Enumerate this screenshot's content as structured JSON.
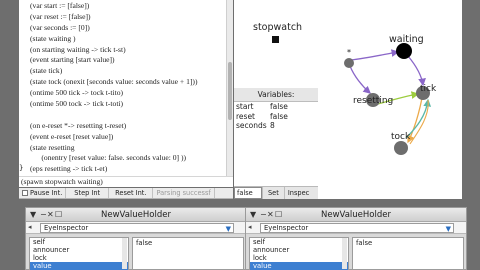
{
  "code": {
    "lines": [
      "(var start := [false])",
      "(var reset := [false])",
      "(var seconds := [0])",
      "(state waiting )",
      "(on starting waiting -> tick t-st)",
      "(event starting [start value])",
      "(state tick)",
      "(state tock (onexit [seconds value: seconds value + 1]))",
      "(ontime 500 tick -> tock t-tito)",
      "(ontime 500 tock -> tick t-toti)",
      "",
      "(on e-reset *-> resetting t-reset)",
      "(event e-reset [reset value])",
      "(state resetting",
      "      (onentry [reset value: false. seconds value: 0] ))",
      "(eps resetting -> tick t-et)",
      "",
      "(on e-stop *-> waiting t-es)",
      "(event e-stop [start value not])"
    ],
    "resize_glyph": "}",
    "eval_text": "(spawn stopwatch waiting)"
  },
  "controls": {
    "pause_label": "Pause Int.",
    "step_label": "Step Int",
    "reset_label": "Reset Int.",
    "parsing_label": "Parsing successf"
  },
  "morph": {
    "label": "stopwatch"
  },
  "variables": {
    "header": "Variables:",
    "rows": [
      {
        "name": "start",
        "value": "false"
      },
      {
        "name": "reset",
        "value": "false"
      },
      {
        "name": "seconds",
        "value": "8"
      }
    ],
    "set_value": "false",
    "set_label": "Set",
    "inspect_label": "Inspec"
  },
  "diagram": {
    "states": {
      "waiting": "waiting",
      "tick": "tick",
      "resetting": "resetting",
      "tock": "tock",
      "star": "*"
    }
  },
  "inspectors": [
    {
      "title": "NewValueHolder",
      "type_label": "EyeInspector",
      "fields": [
        "self",
        "announcer",
        "lock",
        "value"
      ],
      "selected_index": 3,
      "value_text": "false"
    },
    {
      "title": "NewValueHolder",
      "type_label": "EyeInspector",
      "fields": [
        "self",
        "announcer",
        "lock",
        "value"
      ],
      "selected_index": 3,
      "value_text": "false"
    }
  ],
  "colors": {
    "desktop": "#6e6e6e",
    "selection": "#3d7fd1",
    "state_fill": "#6d6d6d",
    "active_state_fill": "#000000",
    "arrow_purple": "#8a66c8",
    "arrow_green": "#9ccc3e",
    "arrow_orange": "#ecaa4a",
    "arrow_teal": "#5ab8a8"
  }
}
